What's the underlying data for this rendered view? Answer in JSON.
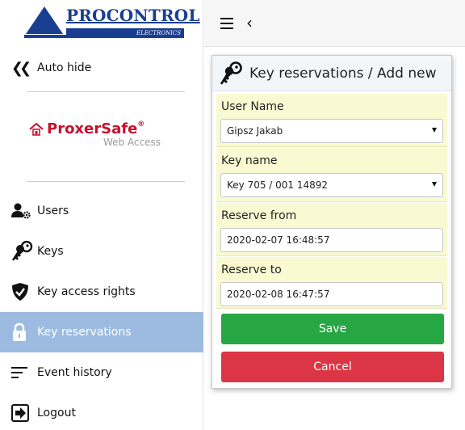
{
  "brand": {
    "name": "PROCONTROL",
    "subtitle": "ELECTRONICS",
    "color": "#1a3e8f"
  },
  "sidebar": {
    "autohide_label": "Auto hide",
    "product": {
      "name": "ProxerSafe",
      "mark": "®",
      "subtitle": "Web Access",
      "color": "#c8102e"
    },
    "items": [
      {
        "label": "Users",
        "icon": "users-gear-icon",
        "active": false
      },
      {
        "label": "Keys",
        "icon": "keys-icon",
        "active": false
      },
      {
        "label": "Key access rights",
        "icon": "shield-check-icon",
        "active": false
      },
      {
        "label": "Key reservations",
        "icon": "padlock-icon",
        "active": true
      },
      {
        "label": "Event history",
        "icon": "lines-icon",
        "active": false
      },
      {
        "label": "Logout",
        "icon": "logout-icon",
        "active": false
      }
    ],
    "active_color": "#9dbbe0"
  },
  "topbar": {
    "menu_icon": "hamburger-icon",
    "back_icon": "chevron-left-icon"
  },
  "form": {
    "title": "Key reservations / Add new",
    "fields": {
      "user_name": {
        "label": "User Name",
        "value": "Gipsz Jakab"
      },
      "key_name": {
        "label": "Key name",
        "value": "Key 705 / 001 14892"
      },
      "reserve_from": {
        "label": "Reserve from",
        "value": "2020-02-07 16:48:57"
      },
      "reserve_to": {
        "label": "Reserve to",
        "value": "2020-02-08 16:47:57"
      }
    },
    "save_label": "Save",
    "cancel_label": "Cancel",
    "field_bg": "#fafad2",
    "save_color": "#27a744",
    "cancel_color": "#dc3545"
  }
}
